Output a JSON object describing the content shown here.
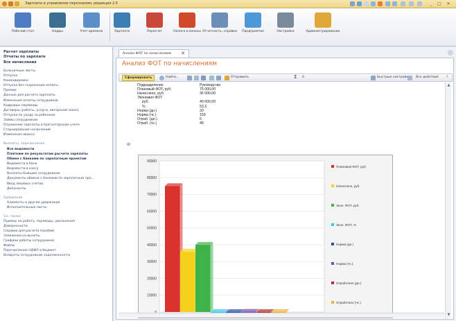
{
  "window": {
    "title": "Зарплата и управление персоналом, редакция 2.5"
  },
  "ribbon": {
    "buttons": [
      {
        "label": "Рабочий стол",
        "color": "#4f7cc2"
      },
      {
        "label": "Кадры",
        "color": "#3b6e8f"
      },
      {
        "label": "Учет времени",
        "color": "#5b8fc7"
      },
      {
        "label": "Зарплата",
        "color": "#3c7fb5"
      },
      {
        "label": "Пересчет",
        "color": "#c9483a"
      },
      {
        "label": "Налоги и взносы",
        "color": "#d04a2a"
      },
      {
        "label": "Отчетность, справки",
        "color": "#6c8fb8"
      },
      {
        "label": "Предприятие",
        "color": "#4c98d8"
      },
      {
        "label": "Настройка",
        "color": "#7a8a99"
      },
      {
        "label": "Администрирование",
        "color": "#e0a83a"
      }
    ]
  },
  "sidebar": {
    "heads": [
      "Расчет зарплаты",
      "Отчеты по зарплате",
      "Все начисления"
    ],
    "items1": [
      "Больничные листы",
      "Отпуска",
      "Командировки",
      "Отпуска без сохранения оплаты",
      "Премии",
      "Данные для расчета зарплаты",
      "Изменения оплаты сотрудников",
      "Кадровые переводы",
      "Договоры (работы, услуги, авторский заказ)",
      "Отпуска по уходу за ребенком",
      "Займы сотрудникам",
      "Отражение зарплаты в бухгалтерском учете",
      "Сторнирование начислений",
      "Изменения аванса"
    ],
    "group2": "Выплаты, перечисления",
    "bold_items": [
      "Все ведомости",
      "Платежи по результатам расчета зарплаты",
      "Обмен с банками по зарплатным проектам"
    ],
    "items2": [
      "Ведомости в банк",
      "Ведомости в кассу",
      "Выплаты бывшим сотрудникам",
      "Документы обмена с банками по зарплатным про...",
      "Ввод лицевых счетов",
      "Депоненты"
    ],
    "group3": "Удержания",
    "items3": [
      "Алименты и другие удержания",
      "Исполнительные листы"
    ],
    "group4": "См. также",
    "items4": [
      "Приемы на работу, переводы, увольнения",
      "Доверенности",
      "Справки для расчета пособий",
      "Заявления на вычеты",
      "Графики работы сотрудников",
      "Файлы",
      "Перечисление НДФЛ в бюджет",
      "Возвраты сотрудникам задолженности"
    ]
  },
  "tab": {
    "label": "Анализ ФОТ по начислениям",
    "close": "✕"
  },
  "report": {
    "title": "Анализ ФОТ по начислениям",
    "toolbar": {
      "generate": "Сформировать",
      "find": "Найти...",
      "send": "Отправить",
      "sum": "Σ",
      "sum_value": "0",
      "quick": "Быстрые настройки",
      "all_actions": "Все действия"
    },
    "rows": [
      {
        "label": "Подразделение",
        "value": "Руководство"
      },
      {
        "label": "Плановый ФОТ, руб.",
        "value": "75 000,00"
      },
      {
        "label": "Начислено, руб.",
        "value": "36 000,00"
      },
      {
        "label": "Экономия ФОТ",
        "value": ""
      },
      {
        "label": "руб.",
        "value": "40 000,00"
      },
      {
        "label": "%",
        "value": "53,3"
      },
      {
        "label": "Норма (дн.)",
        "value": "20"
      },
      {
        "label": "Норма (чс.)",
        "value": "159"
      },
      {
        "label": "Отраб. (дн.)",
        "value": "6"
      },
      {
        "label": "Отраб. (чс.)",
        "value": "48"
      }
    ],
    "expand": "⊞"
  },
  "chart_data": {
    "type": "bar",
    "ylim": [
      0,
      90000
    ],
    "y_ticks": [
      "0",
      "10000",
      "20000",
      "30000",
      "40000",
      "50000",
      "60000",
      "70000",
      "80000",
      "90000"
    ],
    "series": [
      {
        "name": "Плановый ФОТ, руб.",
        "values": [
          75000
        ],
        "color": "#d9312c"
      },
      {
        "name": "Начислено, руб.",
        "values": [
          36000
        ],
        "color": "#f6d11a"
      },
      {
        "name": "Экон. ФОТ, руб.",
        "values": [
          40000
        ],
        "color": "#3fb34a"
      },
      {
        "name": "Экон. ФОТ, %",
        "values": [
          53.3
        ],
        "color": "#39c6e8"
      },
      {
        "name": "Норма (дн.)",
        "values": [
          20
        ],
        "color": "#2c4fa3"
      },
      {
        "name": "Норма (чс.)",
        "values": [
          159
        ],
        "color": "#7a4fb0"
      },
      {
        "name": "Отработано (дн.)",
        "values": [
          6
        ],
        "color": "#b5302a"
      },
      {
        "name": "Отработано (чс.)",
        "values": [
          48
        ],
        "color": "#f2b433"
      }
    ],
    "grid": true,
    "legend_position": "right"
  }
}
